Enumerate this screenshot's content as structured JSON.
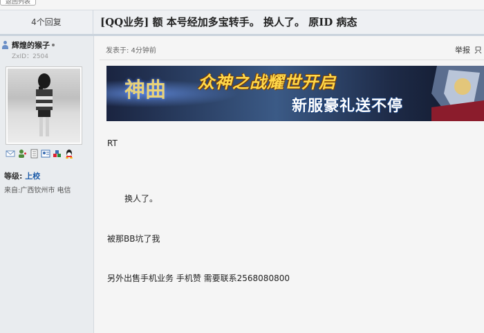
{
  "top_stub": {
    "label": "返回列表"
  },
  "header": {
    "reply_count": "4个回复",
    "title": "[QQ业务] 额 本号经加多宝转手。 换人了。 原ID 病态"
  },
  "profile": {
    "username": "辉煌的猴子",
    "zxid": "ZxID：2504",
    "rank_label": "等级:",
    "rank_value": "上校",
    "location": "来自:广西钦州市 电信",
    "action_icons": [
      "mail-icon",
      "add-friend-icon",
      "document-icon",
      "profile-card-icon",
      "group-icon",
      "qq-icon"
    ]
  },
  "post": {
    "posted_time": "发表于: 4分钟前",
    "report_label": "举报",
    "report_extra": "只",
    "banner": {
      "logo_text": "神曲",
      "slogan_1": "众神之战耀世开启",
      "slogan_2": "新服豪礼送不停"
    },
    "body_lines": [
      "RT",
      "换人了。",
      "被那BB坑了我",
      "另外出售手机业务    手机赞      需要联系2568080800"
    ]
  },
  "colors": {
    "rank_value": "#1a5aa8",
    "header_bg": "#eef0f3",
    "profile_bg": "#e9ecef"
  }
}
